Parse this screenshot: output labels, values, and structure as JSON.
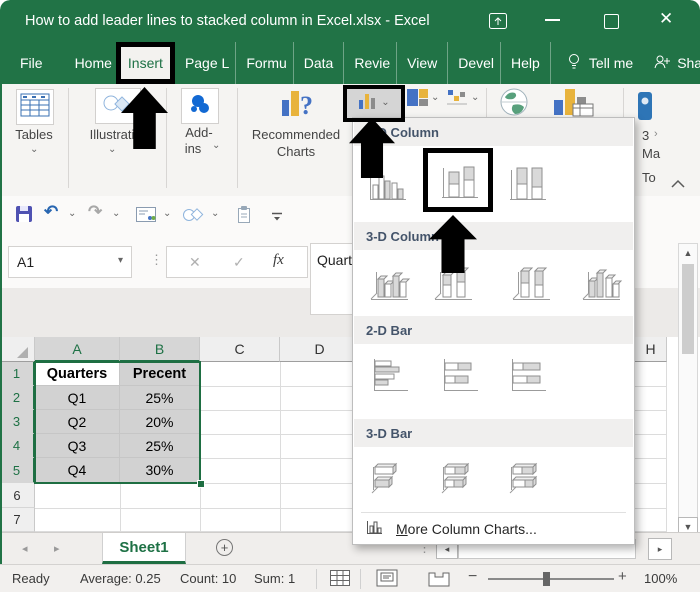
{
  "colors": {
    "excel_green": "#217346",
    "selection_fill": "#d2d2d2",
    "accent_blue": "#4472c4",
    "accent_yellow": "#e8b33c",
    "annotation_black": "#000000"
  },
  "title_bar": {
    "title": "How to add leader lines to stacked column in Excel.xlsx  -  Excel"
  },
  "tabs": {
    "file": "File",
    "home": "Home",
    "insert": "Insert",
    "page_layout": "Page L",
    "formulas": "Formu",
    "data": "Data",
    "review": "Revie",
    "view": "View",
    "developer": "Devel",
    "help": "Help",
    "tell_me": "Tell me",
    "share": "Share"
  },
  "ribbon": {
    "tables": "Tables",
    "illustrations": "Illustrati",
    "addins_1": "Add-",
    "addins_2": "ins",
    "recommended_1": "Recommended",
    "recommended_2": "Charts",
    "map_truncated_1": "3",
    "map_truncated_2": "Ma",
    "map_truncated_3": "To"
  },
  "quick_access": {
    "icons": [
      "save",
      "undo",
      "redo",
      "contact-card",
      "shapes",
      "clipboard",
      "customize-toolbar"
    ]
  },
  "formula_row": {
    "name_box": "A1",
    "formula_value": "Quarters"
  },
  "chart_dropdown": {
    "sections": [
      {
        "label": "2-D Column",
        "items": [
          "clustered-column",
          "stacked-column",
          "100-stacked-column"
        ],
        "highlighted": "stacked-column"
      },
      {
        "label": "3-D Column",
        "items": [
          "3d-clustered-column",
          "3d-stacked-column",
          "3d-100-stacked-column",
          "3d-column"
        ]
      },
      {
        "label": "2-D Bar",
        "items": [
          "clustered-bar",
          "stacked-bar",
          "100-stacked-bar"
        ]
      },
      {
        "label": "3-D Bar",
        "items": [
          "3d-clustered-bar",
          "3d-stacked-bar",
          "3d-100-stacked-bar"
        ]
      }
    ],
    "footer": "More Column Charts..."
  },
  "sheet": {
    "col_headers": [
      "A",
      "B",
      "C",
      "D",
      "H"
    ],
    "row_headers": [
      "1",
      "2",
      "3",
      "4",
      "5",
      "6",
      "7"
    ],
    "selection": "A1:B5",
    "table": {
      "headers": [
        "Quarters",
        "Precent"
      ],
      "rows": [
        [
          "Q1",
          "25%"
        ],
        [
          "Q2",
          "20%"
        ],
        [
          "Q3",
          "25%"
        ],
        [
          "Q4",
          "30%"
        ]
      ]
    },
    "tab_name": "Sheet1"
  },
  "status_bar": {
    "mode": "Ready",
    "average": "Average: 0.25",
    "count": "Count: 10",
    "sum": "Sum: 1",
    "zoom": "100%"
  },
  "annotations": [
    {
      "type": "box",
      "target": "insert-tab"
    },
    {
      "type": "arrow-up",
      "target": "insert-tab"
    },
    {
      "type": "box",
      "target": "column-chart-button"
    },
    {
      "type": "arrow-up",
      "target": "column-chart-button"
    },
    {
      "type": "box",
      "target": "stacked-column-option"
    },
    {
      "type": "arrow-up",
      "target": "stacked-column-option"
    }
  ]
}
